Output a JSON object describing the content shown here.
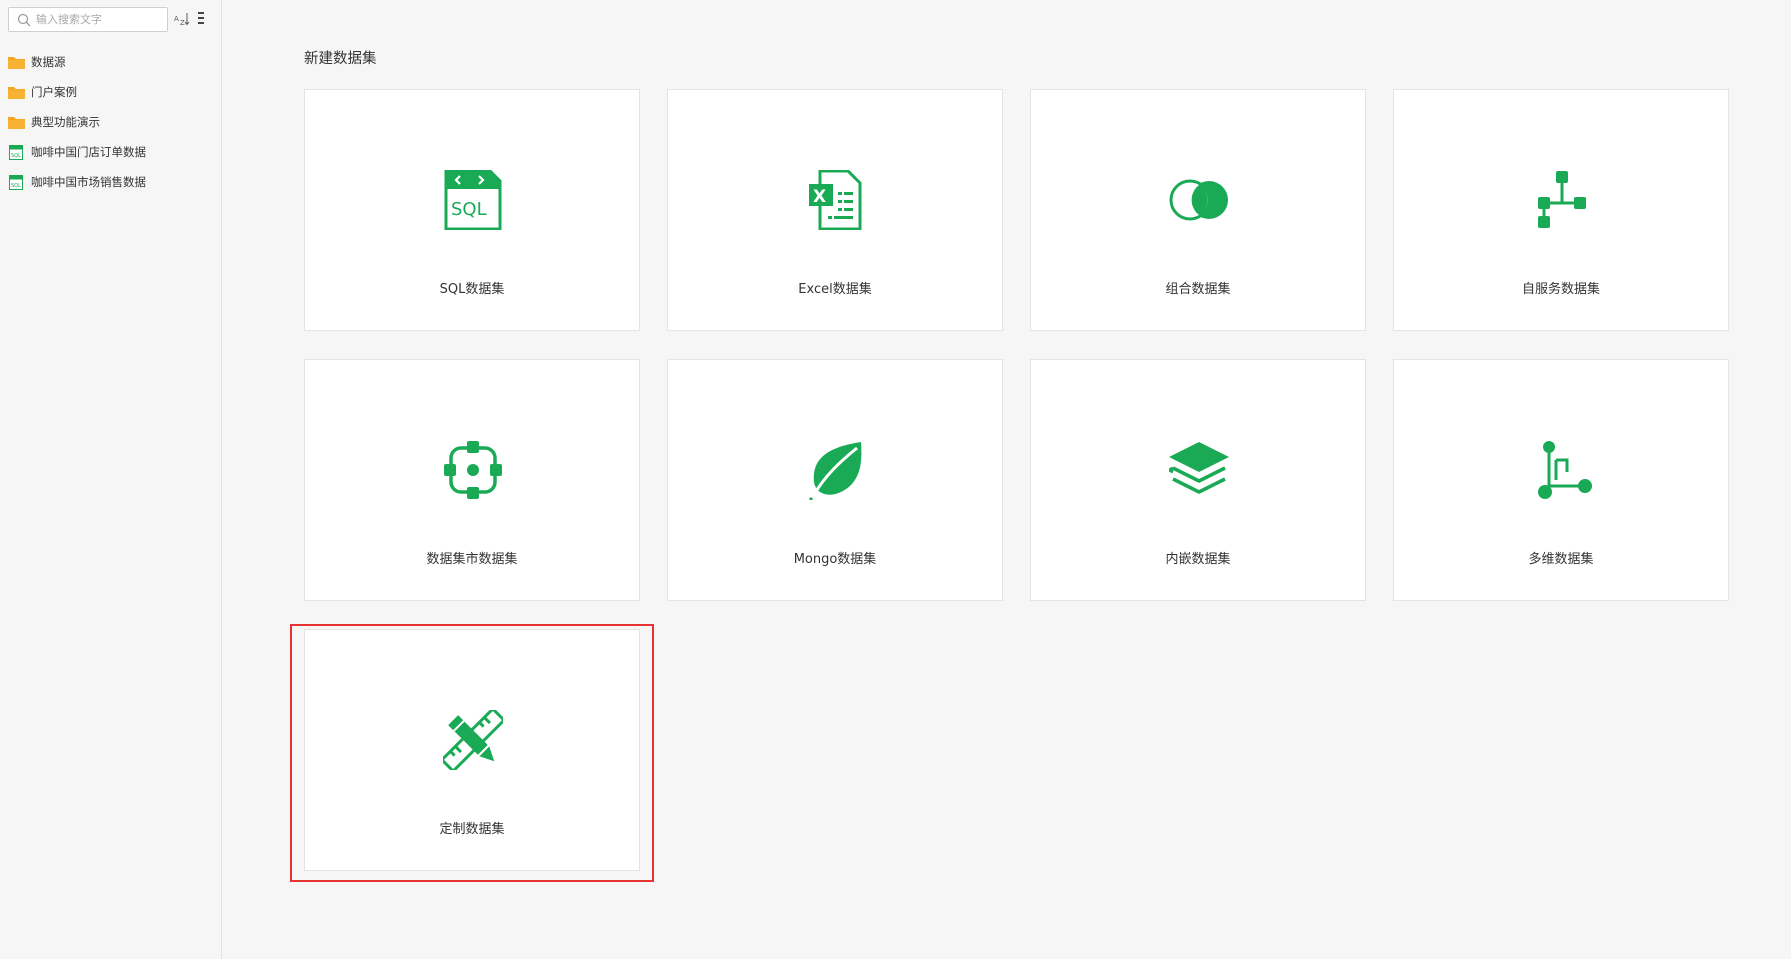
{
  "sidebar": {
    "search": {
      "placeholder": "输入搜索文字",
      "value": ""
    },
    "sort_icon_text": "A-Z",
    "items": [
      {
        "label": "数据源",
        "icon": "folder-icon"
      },
      {
        "label": "门户案例",
        "icon": "folder-icon"
      },
      {
        "label": "典型功能演示",
        "icon": "folder-icon"
      },
      {
        "label": "咖啡中国门店订单数据",
        "icon": "sql-dataset-icon"
      },
      {
        "label": "咖啡中国市场销售数据",
        "icon": "sql-dataset-icon"
      }
    ]
  },
  "main": {
    "title": "新建数据集",
    "cards": [
      {
        "label": "SQL数据集",
        "icon": "sql-icon"
      },
      {
        "label": "Excel数据集",
        "icon": "excel-icon"
      },
      {
        "label": "组合数据集",
        "icon": "combine-icon"
      },
      {
        "label": "自服务数据集",
        "icon": "self-service-icon"
      },
      {
        "label": "数据集市数据集",
        "icon": "data-mart-icon"
      },
      {
        "label": "Mongo数据集",
        "icon": "mongo-leaf-icon"
      },
      {
        "label": "内嵌数据集",
        "icon": "embedded-layers-icon"
      },
      {
        "label": "多维数据集",
        "icon": "multidimensional-icon"
      },
      {
        "label": "定制数据集",
        "icon": "custom-pencil-ruler-icon"
      }
    ],
    "highlighted_card": "定制数据集"
  },
  "colors": {
    "accent": "#1aaa55",
    "folder": "#f5a623",
    "highlight": "#e53333",
    "background": "#f6f6f6"
  }
}
